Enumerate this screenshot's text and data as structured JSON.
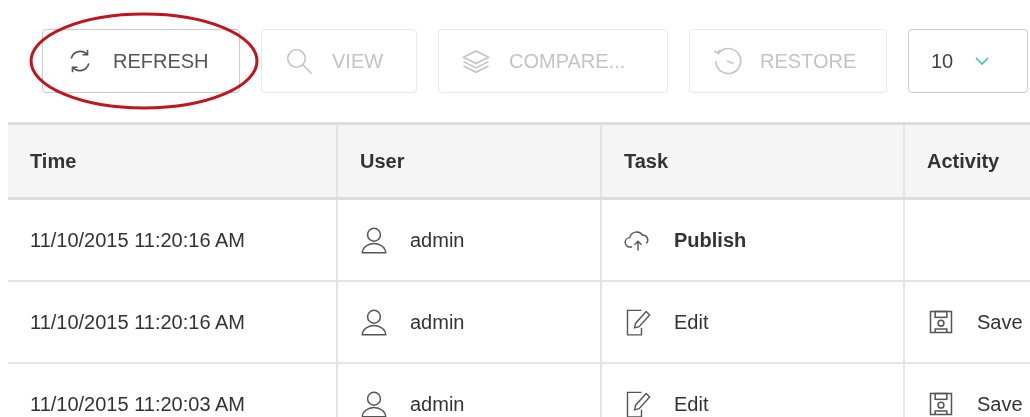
{
  "toolbar": {
    "buttons": [
      {
        "kind": "refresh",
        "label": "REFRESH",
        "disabled": false,
        "highlighted": true
      },
      {
        "kind": "view",
        "label": "VIEW",
        "disabled": true,
        "highlighted": false
      },
      {
        "kind": "compare",
        "label": "COMPARE...",
        "disabled": true,
        "highlighted": false
      },
      {
        "kind": "restore",
        "label": "RESTORE",
        "disabled": true,
        "highlighted": false
      }
    ],
    "page_size": {
      "value": "10"
    }
  },
  "table": {
    "columns": [
      "Time",
      "User",
      "Task",
      "Activity"
    ],
    "rows": [
      {
        "time": "11/10/2015 11:20:16 AM",
        "user": "admin",
        "task": {
          "kind": "publish",
          "label": "Publish"
        }
      },
      {
        "time": "11/10/2015 11:20:16 AM",
        "user": "admin",
        "task": {
          "kind": "edit",
          "label": "Edit"
        },
        "activity": {
          "kind": "save",
          "label": "Save"
        }
      },
      {
        "time": "11/10/2015 11:20:03 AM",
        "user": "admin",
        "task": {
          "kind": "edit",
          "label": "Edit"
        },
        "activity": {
          "kind": "save",
          "label": "Save"
        }
      }
    ]
  }
}
